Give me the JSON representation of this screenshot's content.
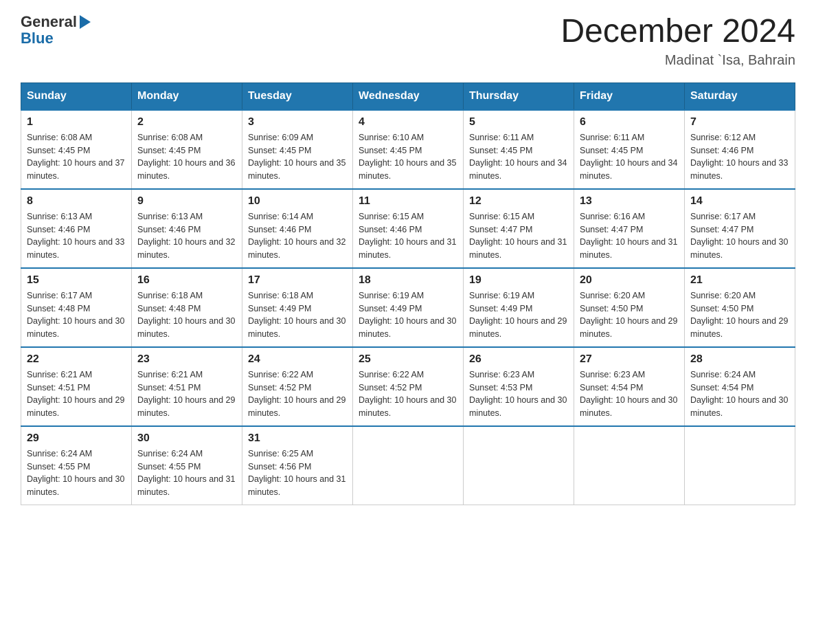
{
  "header": {
    "logo_general": "General",
    "logo_blue": "Blue",
    "title": "December 2024",
    "subtitle": "Madinat `Isa, Bahrain"
  },
  "columns": [
    "Sunday",
    "Monday",
    "Tuesday",
    "Wednesday",
    "Thursday",
    "Friday",
    "Saturday"
  ],
  "weeks": [
    [
      {
        "day": "1",
        "sunrise": "6:08 AM",
        "sunset": "4:45 PM",
        "daylight": "10 hours and 37 minutes."
      },
      {
        "day": "2",
        "sunrise": "6:08 AM",
        "sunset": "4:45 PM",
        "daylight": "10 hours and 36 minutes."
      },
      {
        "day": "3",
        "sunrise": "6:09 AM",
        "sunset": "4:45 PM",
        "daylight": "10 hours and 35 minutes."
      },
      {
        "day": "4",
        "sunrise": "6:10 AM",
        "sunset": "4:45 PM",
        "daylight": "10 hours and 35 minutes."
      },
      {
        "day": "5",
        "sunrise": "6:11 AM",
        "sunset": "4:45 PM",
        "daylight": "10 hours and 34 minutes."
      },
      {
        "day": "6",
        "sunrise": "6:11 AM",
        "sunset": "4:45 PM",
        "daylight": "10 hours and 34 minutes."
      },
      {
        "day": "7",
        "sunrise": "6:12 AM",
        "sunset": "4:46 PM",
        "daylight": "10 hours and 33 minutes."
      }
    ],
    [
      {
        "day": "8",
        "sunrise": "6:13 AM",
        "sunset": "4:46 PM",
        "daylight": "10 hours and 33 minutes."
      },
      {
        "day": "9",
        "sunrise": "6:13 AM",
        "sunset": "4:46 PM",
        "daylight": "10 hours and 32 minutes."
      },
      {
        "day": "10",
        "sunrise": "6:14 AM",
        "sunset": "4:46 PM",
        "daylight": "10 hours and 32 minutes."
      },
      {
        "day": "11",
        "sunrise": "6:15 AM",
        "sunset": "4:46 PM",
        "daylight": "10 hours and 31 minutes."
      },
      {
        "day": "12",
        "sunrise": "6:15 AM",
        "sunset": "4:47 PM",
        "daylight": "10 hours and 31 minutes."
      },
      {
        "day": "13",
        "sunrise": "6:16 AM",
        "sunset": "4:47 PM",
        "daylight": "10 hours and 31 minutes."
      },
      {
        "day": "14",
        "sunrise": "6:17 AM",
        "sunset": "4:47 PM",
        "daylight": "10 hours and 30 minutes."
      }
    ],
    [
      {
        "day": "15",
        "sunrise": "6:17 AM",
        "sunset": "4:48 PM",
        "daylight": "10 hours and 30 minutes."
      },
      {
        "day": "16",
        "sunrise": "6:18 AM",
        "sunset": "4:48 PM",
        "daylight": "10 hours and 30 minutes."
      },
      {
        "day": "17",
        "sunrise": "6:18 AM",
        "sunset": "4:49 PM",
        "daylight": "10 hours and 30 minutes."
      },
      {
        "day": "18",
        "sunrise": "6:19 AM",
        "sunset": "4:49 PM",
        "daylight": "10 hours and 30 minutes."
      },
      {
        "day": "19",
        "sunrise": "6:19 AM",
        "sunset": "4:49 PM",
        "daylight": "10 hours and 29 minutes."
      },
      {
        "day": "20",
        "sunrise": "6:20 AM",
        "sunset": "4:50 PM",
        "daylight": "10 hours and 29 minutes."
      },
      {
        "day": "21",
        "sunrise": "6:20 AM",
        "sunset": "4:50 PM",
        "daylight": "10 hours and 29 minutes."
      }
    ],
    [
      {
        "day": "22",
        "sunrise": "6:21 AM",
        "sunset": "4:51 PM",
        "daylight": "10 hours and 29 minutes."
      },
      {
        "day": "23",
        "sunrise": "6:21 AM",
        "sunset": "4:51 PM",
        "daylight": "10 hours and 29 minutes."
      },
      {
        "day": "24",
        "sunrise": "6:22 AM",
        "sunset": "4:52 PM",
        "daylight": "10 hours and 29 minutes."
      },
      {
        "day": "25",
        "sunrise": "6:22 AM",
        "sunset": "4:52 PM",
        "daylight": "10 hours and 30 minutes."
      },
      {
        "day": "26",
        "sunrise": "6:23 AM",
        "sunset": "4:53 PM",
        "daylight": "10 hours and 30 minutes."
      },
      {
        "day": "27",
        "sunrise": "6:23 AM",
        "sunset": "4:54 PM",
        "daylight": "10 hours and 30 minutes."
      },
      {
        "day": "28",
        "sunrise": "6:24 AM",
        "sunset": "4:54 PM",
        "daylight": "10 hours and 30 minutes."
      }
    ],
    [
      {
        "day": "29",
        "sunrise": "6:24 AM",
        "sunset": "4:55 PM",
        "daylight": "10 hours and 30 minutes."
      },
      {
        "day": "30",
        "sunrise": "6:24 AM",
        "sunset": "4:55 PM",
        "daylight": "10 hours and 31 minutes."
      },
      {
        "day": "31",
        "sunrise": "6:25 AM",
        "sunset": "4:56 PM",
        "daylight": "10 hours and 31 minutes."
      },
      null,
      null,
      null,
      null
    ]
  ]
}
